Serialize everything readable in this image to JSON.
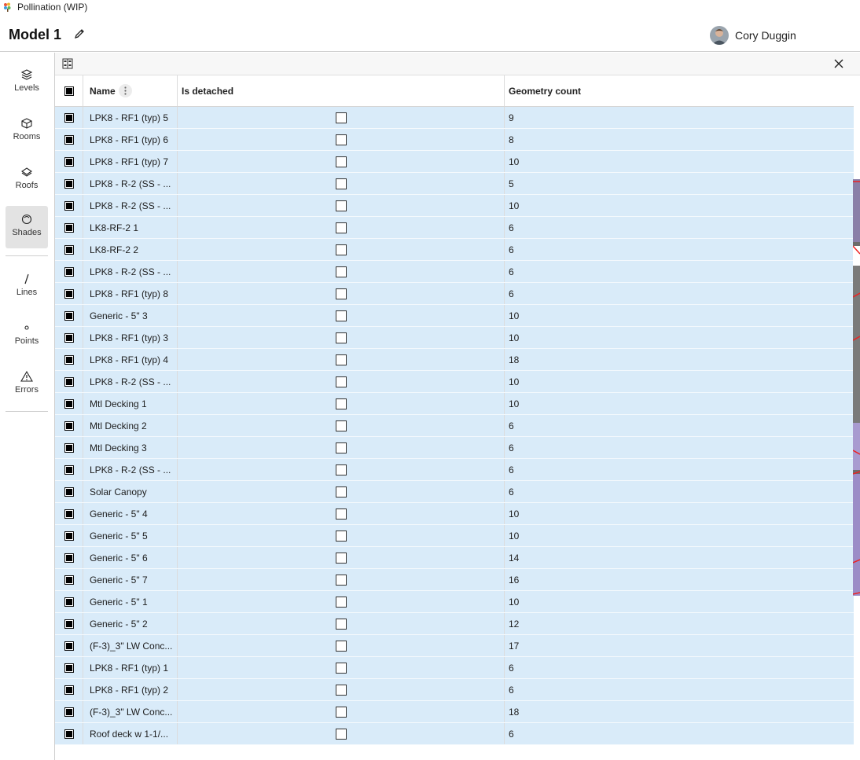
{
  "app": {
    "title": "Pollination (WIP)",
    "logo": "pollination-logo-icon"
  },
  "header": {
    "model_title": "Model 1",
    "edit_icon": "pencil-icon",
    "user_name": "Cory Duggin"
  },
  "sidebar": {
    "items": [
      {
        "label": "Levels",
        "icon": "layers-icon"
      },
      {
        "label": "Rooms",
        "icon": "cube-icon"
      },
      {
        "label": "Roofs",
        "icon": "roof-icon"
      },
      {
        "label": "Shades",
        "icon": "shade-icon",
        "active": true
      },
      {
        "label": "Lines",
        "icon": "line-icon"
      },
      {
        "label": "Points",
        "icon": "point-icon"
      },
      {
        "label": "Errors",
        "icon": "warning-icon"
      }
    ]
  },
  "table": {
    "columns": {
      "name": "Name",
      "detached": "Is detached",
      "geometry": "Geometry count"
    },
    "rows": [
      {
        "name": "LPK8 - RF1 (typ) 5",
        "geometry": "9"
      },
      {
        "name": "LPK8 - RF1 (typ) 6",
        "geometry": "8"
      },
      {
        "name": "LPK8 - RF1 (typ) 7",
        "geometry": "10"
      },
      {
        "name": "LPK8 - R-2 (SS - ...",
        "geometry": "5"
      },
      {
        "name": "LPK8 - R-2 (SS - ...",
        "geometry": "10"
      },
      {
        "name": "LK8-RF-2 1",
        "geometry": "6"
      },
      {
        "name": "LK8-RF-2 2",
        "geometry": "6"
      },
      {
        "name": "LPK8 - R-2 (SS - ...",
        "geometry": "6"
      },
      {
        "name": "LPK8 - RF1 (typ) 8",
        "geometry": "6"
      },
      {
        "name": "Generic - 5\" 3",
        "geometry": "10"
      },
      {
        "name": "LPK8 - RF1 (typ) 3",
        "geometry": "10"
      },
      {
        "name": "LPK8 - RF1 (typ) 4",
        "geometry": "18"
      },
      {
        "name": "LPK8 - R-2 (SS - ...",
        "geometry": "10"
      },
      {
        "name": "Mtl Decking 1",
        "geometry": "10"
      },
      {
        "name": "Mtl Decking 2",
        "geometry": "6"
      },
      {
        "name": "Mtl Decking 3",
        "geometry": "6"
      },
      {
        "name": "LPK8 - R-2 (SS - ...",
        "geometry": "6"
      },
      {
        "name": "Solar Canopy",
        "geometry": "6"
      },
      {
        "name": "Generic - 5\" 4",
        "geometry": "10"
      },
      {
        "name": "Generic - 5\" 5",
        "geometry": "10"
      },
      {
        "name": "Generic - 5\" 6",
        "geometry": "14"
      },
      {
        "name": "Generic - 5\" 7",
        "geometry": "16"
      },
      {
        "name": "Generic - 5\" 1",
        "geometry": "10"
      },
      {
        "name": "Generic - 5\" 2",
        "geometry": "12"
      },
      {
        "name": "(F-3)_3\" LW Conc...",
        "geometry": "17"
      },
      {
        "name": "LPK8 - RF1 (typ) 1",
        "geometry": "6"
      },
      {
        "name": "LPK8 - RF1 (typ) 2",
        "geometry": "6"
      },
      {
        "name": "(F-3)_3\" LW Conc...",
        "geometry": "18"
      },
      {
        "name": "Roof deck w 1-1/...",
        "geometry": "6"
      }
    ]
  },
  "colors": {
    "row_selected": "#d9ebf9",
    "sidebar_active": "#e3e3e3"
  }
}
